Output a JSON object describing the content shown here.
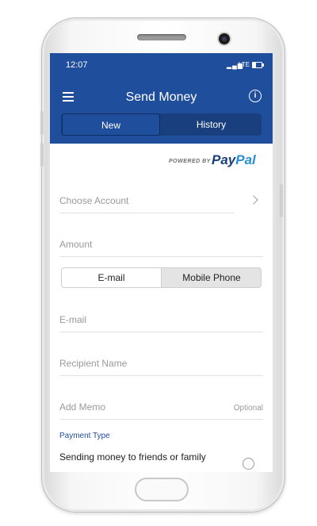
{
  "status": {
    "time": "12:07",
    "network": "LTE"
  },
  "appbar": {
    "title": "Send Money"
  },
  "tabs": [
    {
      "label": "New"
    },
    {
      "label": "History"
    }
  ],
  "branding": {
    "powered_by": "POWERED BY",
    "paypal_pay": "Pay",
    "paypal_pal": "Pal"
  },
  "form": {
    "choose_account": "Choose Account",
    "amount": "Amount",
    "recipient_type": {
      "options": [
        "E-mail",
        "Mobile Phone"
      ],
      "selected": "E-mail"
    },
    "email": "E-mail",
    "recipient_name": "Recipient Name",
    "add_memo": "Add Memo",
    "memo_optional": "Optional",
    "payment_type_label": "Payment Type",
    "payment_type_option": "Sending money to friends or family"
  },
  "colors": {
    "brand_blue": "#1f4e9c",
    "paypal_dark": "#1b3f7a",
    "paypal_light": "#2a8fd6"
  },
  "icons": [
    "hamburger-menu-icon",
    "info-icon",
    "chevron-right-icon",
    "radio-button-icon",
    "signal-icon",
    "battery-icon"
  ]
}
